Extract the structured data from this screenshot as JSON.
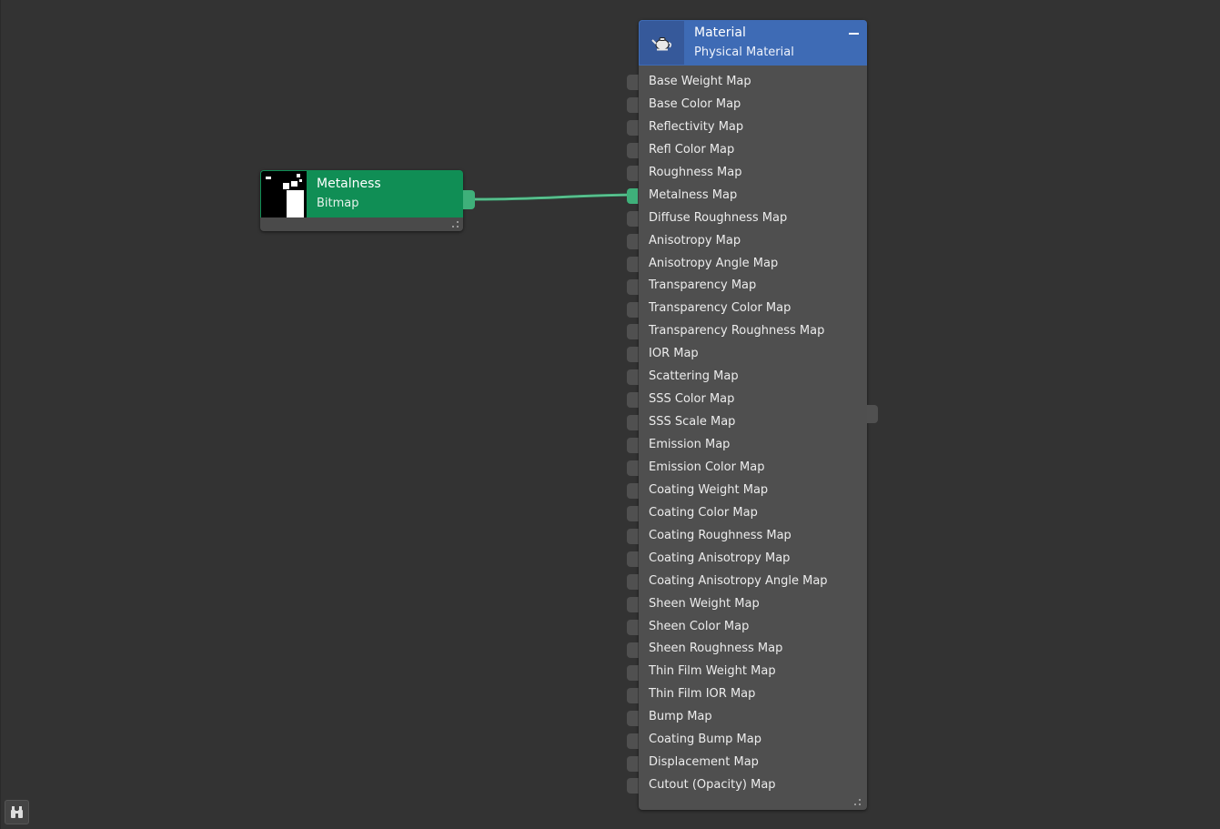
{
  "nodes": {
    "bitmap": {
      "title": "Metalness",
      "subtitle": "Bitmap",
      "color": "#108e55",
      "thumbnail": "metalness-bitmap-preview"
    },
    "material": {
      "title": "Material",
      "subtitle": "Physical Material",
      "color": "#3e6bb5",
      "icon": "teapot-icon",
      "collapse_icon": "minus-icon",
      "sockets": [
        {
          "label": "Base Weight Map",
          "connected": false
        },
        {
          "label": "Base Color Map",
          "connected": false
        },
        {
          "label": "Reflectivity Map",
          "connected": false
        },
        {
          "label": "Refl Color Map",
          "connected": false
        },
        {
          "label": "Roughness Map",
          "connected": false
        },
        {
          "label": "Metalness Map",
          "connected": true
        },
        {
          "label": "Diffuse Roughness Map",
          "connected": false
        },
        {
          "label": "Anisotropy Map",
          "connected": false
        },
        {
          "label": "Anisotropy Angle Map",
          "connected": false
        },
        {
          "label": "Transparency Map",
          "connected": false
        },
        {
          "label": "Transparency Color Map",
          "connected": false
        },
        {
          "label": "Transparency Roughness Map",
          "connected": false
        },
        {
          "label": "IOR Map",
          "connected": false
        },
        {
          "label": "Scattering Map",
          "connected": false
        },
        {
          "label": "SSS Color Map",
          "connected": false
        },
        {
          "label": "SSS Scale Map",
          "connected": false
        },
        {
          "label": "Emission Map",
          "connected": false
        },
        {
          "label": "Emission Color Map",
          "connected": false
        },
        {
          "label": "Coating Weight Map",
          "connected": false
        },
        {
          "label": "Coating Color Map",
          "connected": false
        },
        {
          "label": "Coating Roughness Map",
          "connected": false
        },
        {
          "label": "Coating Anisotropy Map",
          "connected": false
        },
        {
          "label": "Coating Anisotropy Angle Map",
          "connected": false
        },
        {
          "label": "Sheen Weight Map",
          "connected": false
        },
        {
          "label": "Sheen Color Map",
          "connected": false
        },
        {
          "label": "Sheen Roughness Map",
          "connected": false
        },
        {
          "label": "Thin Film Weight Map",
          "connected": false
        },
        {
          "label": "Thin Film IOR Map",
          "connected": false
        },
        {
          "label": "Bump Map",
          "connected": false
        },
        {
          "label": "Coating Bump Map",
          "connected": false
        },
        {
          "label": "Displacement Map",
          "connected": false
        },
        {
          "label": "Cutout (Opacity) Map",
          "connected": false
        }
      ]
    }
  },
  "connection": {
    "from": "Metalness",
    "to": "Metalness Map",
    "color": "#3fb07a"
  },
  "toolbar": {
    "overview_icon": "binoculars-icon"
  },
  "colors": {
    "background": "#333333",
    "node_body": "#4f4f4f",
    "port_connected": "#3fb07a",
    "port_idle": "#505050"
  }
}
